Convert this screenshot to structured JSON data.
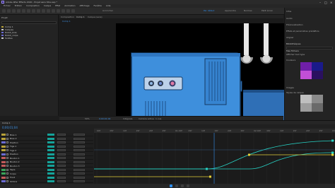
{
  "app": {
    "title": "Adobe After Effects 2020 - Projet sans titre.aep *",
    "menu": [
      "Fichier",
      "Edition",
      "Composition",
      "Calque",
      "Effet",
      "Animation",
      "Affichage",
      "Fenêtre",
      "Aide"
    ],
    "workspace_tabs": [
      {
        "label": "Par défaut",
        "active": true
      },
      {
        "label": "Apprendre",
        "active": false
      },
      {
        "label": "Normes",
        "active": false
      },
      {
        "label": "Petit écran",
        "active": false
      }
    ],
    "toolbar_labels": {
      "snap": "Accrocher"
    }
  },
  "project": {
    "tab": "Projet",
    "rows": [
      {
        "name": "Comp 1",
        "color": "#b8a23a"
      },
      {
        "name": "Calques",
        "color": "#c9c9c9"
      },
      {
        "name": "Robot_bras",
        "color": "#6b6bd1"
      },
      {
        "name": "Robot_corps",
        "color": "#6b6bd1"
      },
      {
        "name": "Solides",
        "color": "#c9c9c9"
      }
    ]
  },
  "composition": {
    "tabs": [
      "Composition",
      "Comp 1",
      "Calque (sans)"
    ],
    "active_tab": "Comp 1",
    "viewer_bar": {
      "zoom": "50%",
      "time": "0;00;01;04",
      "resolution": "Intégrale",
      "camera": "Caméra active",
      "view": "1 vue"
    },
    "machine_buttons": [
      "●",
      "●",
      "●"
    ]
  },
  "right_panel": {
    "sections": [
      "Infos",
      "Audio",
      "Prévisualisation",
      "Effets et paramètres prédéfinis",
      "Aligner",
      "Bibliothèques"
    ],
    "library": "Bibliothèques",
    "library_search": "Rechercher dans la bibliothèque actuelle",
    "library_name": "Mes fichiers",
    "library_filter": "Afficher tout type",
    "colors_label": "Couleurs",
    "graphics_label": "Images",
    "styles_label": "Styles de calque",
    "colors": [
      "#6f1fa8",
      "#1a1a8a",
      "#c24fd6",
      "#2a1060"
    ],
    "grays": [
      "#bfbfbf",
      "#8a8a8a",
      "#9d9d9d",
      "#6a6a6a"
    ]
  },
  "timeline": {
    "tab": "Comp 1",
    "timecode": "0;00;01;04",
    "ruler_ticks": [
      "00f",
      "05f",
      "10f",
      "15f",
      "20f",
      "25f",
      "01:00f",
      "05f",
      "10f",
      "15f",
      "20f",
      "25f",
      "02:00f",
      "05f",
      "10f",
      "15f",
      "20f",
      "25f",
      "03:00f"
    ],
    "layers": [
      {
        "name": "Bras 1",
        "color": "#b8a23a"
      },
      {
        "name": "Bras 2",
        "color": "#b8a23a"
      },
      {
        "name": "Position",
        "color": "#6b6bd1"
      },
      {
        "name": "Tige 1",
        "color": "#b8a23a"
      },
      {
        "name": "Tige 2",
        "color": "#b8a23a"
      },
      {
        "name": "Position",
        "color": "#6b6bd1"
      },
      {
        "name": "Bouton 1",
        "color": "#c25a5a"
      },
      {
        "name": "Bouton 2",
        "color": "#c25a5a"
      },
      {
        "name": "Bouton 3",
        "color": "#c25a5a"
      },
      {
        "name": "Tapis",
        "color": "#3aa35a"
      },
      {
        "name": "Corps",
        "color": "#3aa35a"
      },
      {
        "name": "Fond",
        "color": "#c25a5a"
      },
      {
        "name": "Ombre",
        "color": "#6b6bd1"
      }
    ],
    "graph_colors": {
      "cyan": "#27d3c6",
      "yellow": "#e6d23a",
      "grid": "#2c2c2c"
    }
  }
}
